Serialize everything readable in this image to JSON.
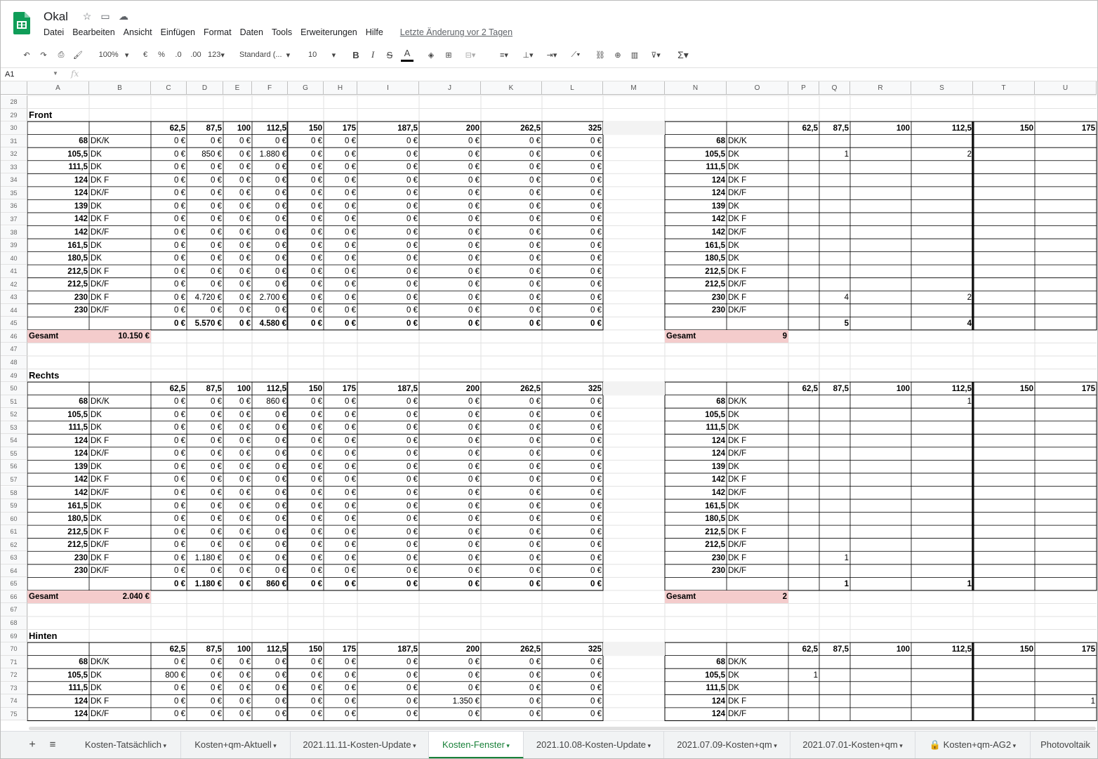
{
  "doc_title": "Okal",
  "menus": [
    "Datei",
    "Bearbeiten",
    "Ansicht",
    "Einfügen",
    "Format",
    "Daten",
    "Tools",
    "Erweiterungen",
    "Hilfe"
  ],
  "last_edit": "Letzte Änderung vor 2 Tagen",
  "toolbar": {
    "zoom": "100%",
    "currency": "€",
    "percent": "%",
    "dec_less": ".0",
    "dec_more": ".00",
    "number_format": "123",
    "font": "Standard (...",
    "font_size": "10"
  },
  "name_box": "A1",
  "fx": "fx",
  "columns": [
    "A",
    "B",
    "C",
    "D",
    "E",
    "F",
    "G",
    "H",
    "I",
    "J",
    "K",
    "L",
    "M",
    "N",
    "O",
    "P",
    "Q",
    "R",
    "S",
    "T",
    "U"
  ],
  "rows_start": 28,
  "rows_end": 75,
  "size_headers": [
    "62,5",
    "87,5",
    "100",
    "112,5",
    "150",
    "175",
    "187,5",
    "200",
    "262,5",
    "325"
  ],
  "right_headers": [
    "62,5",
    "87,5",
    "100",
    "112,5",
    "150",
    "175"
  ],
  "row_labels": [
    [
      "68",
      "DK/K"
    ],
    [
      "105,5",
      "DK"
    ],
    [
      "111,5",
      "DK"
    ],
    [
      "124",
      "DK F"
    ],
    [
      "124",
      "DK/F"
    ],
    [
      "139",
      "DK"
    ],
    [
      "142",
      "DK F"
    ],
    [
      "142",
      "DK/F"
    ],
    [
      "161,5",
      "DK"
    ],
    [
      "180,5",
      "DK"
    ],
    [
      "212,5",
      "DK F"
    ],
    [
      "212,5",
      "DK/F"
    ],
    [
      "230",
      "DK F"
    ],
    [
      "230",
      "DK/F"
    ]
  ],
  "sections": [
    {
      "title": "Front",
      "title_row": 29,
      "header_row": 30,
      "cells": {
        "32": {
          "D": "850 €",
          "F": "1.880 €"
        },
        "43": {
          "D": "4.720 €",
          "F": "2.700 €"
        }
      },
      "totals": [
        "0 €",
        "5.570 €",
        "0 €",
        "4.580 €",
        "0 €",
        "0 €",
        "0 €",
        "0 €",
        "0 €",
        "0 €"
      ],
      "gesamt_label": "Gesamt",
      "gesamt": "10.150 €",
      "right_cells": {
        "32": {
          "Q": "1",
          "S": "2"
        },
        "43": {
          "Q": "4",
          "S": "2"
        }
      },
      "right_totals": {
        "Q": "5",
        "S": "4"
      },
      "right_gesamt": "9"
    },
    {
      "title": "Rechts",
      "title_row": 49,
      "header_row": 50,
      "cells": {
        "51": {
          "F": "860 €"
        },
        "63": {
          "D": "1.180 €"
        }
      },
      "totals": [
        "0 €",
        "1.180 €",
        "0 €",
        "860 €",
        "0 €",
        "0 €",
        "0 €",
        "0 €",
        "0 €",
        "0 €"
      ],
      "gesamt_label": "Gesamt",
      "gesamt": "2.040 €",
      "right_cells": {
        "51": {
          "S": "1"
        },
        "63": {
          "Q": "1"
        }
      },
      "right_totals": {
        "Q": "1",
        "S": "1"
      },
      "right_gesamt": "2"
    },
    {
      "title": "Hinten",
      "title_row": 69,
      "header_row": 70,
      "cells": {
        "72": {
          "C": "800 €"
        },
        "74": {
          "J": "1.350 €"
        }
      },
      "totals": null,
      "right_cells": {
        "72": {
          "P": "1"
        },
        "74": {
          "U": "1"
        }
      }
    }
  ],
  "zero": "0 €",
  "sheets": [
    {
      "label": "Kosten-Tatsächlich",
      "active": false
    },
    {
      "label": "Kosten+qm-Aktuell",
      "active": false
    },
    {
      "label": "2021.11.11-Kosten-Update",
      "active": false
    },
    {
      "label": "Kosten-Fenster",
      "active": true
    },
    {
      "label": "2021.10.08-Kosten-Update",
      "active": false
    },
    {
      "label": "2021.07.09-Kosten+qm",
      "active": false
    },
    {
      "label": "2021.07.01-Kosten+qm",
      "active": false
    },
    {
      "label": "Kosten+qm-AG2",
      "active": false,
      "locked": true
    },
    {
      "label": "Photovoltaik",
      "active": false
    }
  ],
  "colors": {
    "accent": "#188038",
    "gesamt_bg": "#f4cccc"
  }
}
